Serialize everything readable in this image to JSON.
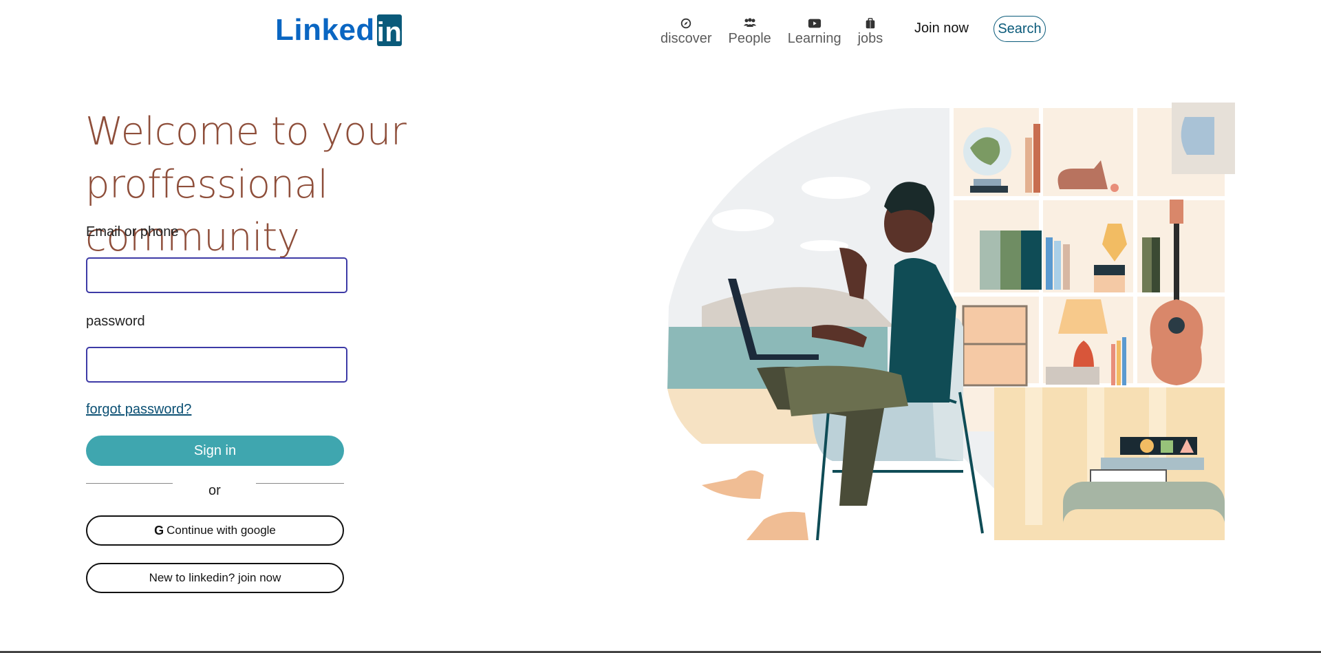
{
  "header": {
    "logo_text": "Linked",
    "logo_box": "in",
    "nav": [
      {
        "label": "discover",
        "icon": "compass-icon"
      },
      {
        "label": "People",
        "icon": "people-icon"
      },
      {
        "label": "Learning",
        "icon": "play-icon"
      },
      {
        "label": "jobs",
        "icon": "briefcase-icon"
      }
    ],
    "join_label": "Join now",
    "search_label": "Search"
  },
  "main": {
    "headline_line1": "Welcome to your",
    "headline_line2": "proffessional community",
    "email_label": "Email or phone",
    "email_value": "",
    "password_label": "password",
    "password_value": "",
    "forgot_label": "forgot password?",
    "signin_label": "Sign in",
    "or_label": "or",
    "google_label": "Continue with google",
    "google_glyph": "G",
    "join_label": "New to linkedin? join now"
  },
  "colors": {
    "brand_blue": "#0a66c2",
    "accent_teal": "#3fa6af",
    "headline_brown": "#8e4e3a",
    "field_border": "#3d3aa6"
  }
}
